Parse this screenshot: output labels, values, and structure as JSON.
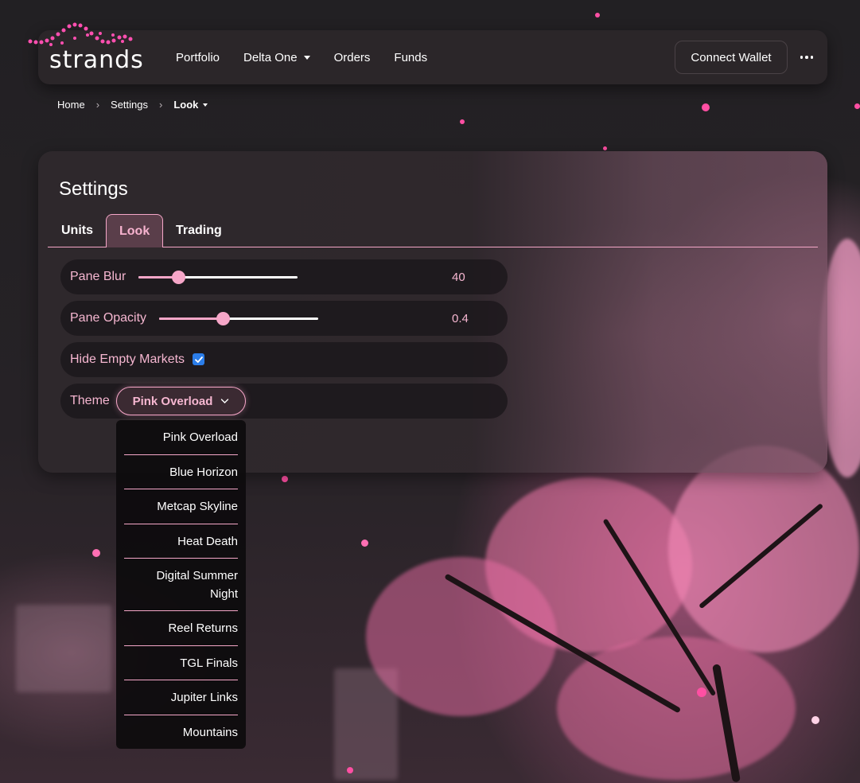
{
  "header": {
    "logo_text": "strands",
    "nav": [
      {
        "label": "Portfolio"
      },
      {
        "label": "Delta One",
        "has_dropdown": true
      },
      {
        "label": "Orders"
      },
      {
        "label": "Funds"
      }
    ],
    "connect_wallet_label": "Connect Wallet",
    "more_icon": "more-horizontal-icon"
  },
  "breadcrumb": {
    "items": [
      "Home",
      "Settings"
    ],
    "current": "Look",
    "separator_icon": "chevron-right-icon"
  },
  "settings": {
    "title": "Settings",
    "tabs": [
      "Units",
      "Look",
      "Trading"
    ],
    "active_tab": "Look",
    "pane_blur": {
      "label": "Pane Blur",
      "value": "40",
      "level": 0.25
    },
    "pane_opacity": {
      "label": "Pane Opacity",
      "value": "0.4",
      "level": 0.4
    },
    "hide_empty_markets": {
      "label": "Hide Empty Markets",
      "checked": true
    },
    "theme": {
      "label": "Theme",
      "selected": "Pink Overload"
    }
  },
  "theme_options": [
    "Pink Overload",
    "Blue Horizon",
    "Metcap Skyline",
    "Heat Death",
    "Digital Summer Night",
    "Reel Returns",
    "TGL Finals",
    "Jupiter Links",
    "Mountains"
  ],
  "colors": {
    "accent_pink": "#f6a6c8",
    "panel_bg": "#2e282c",
    "checkbox_blue": "#2b7de9"
  }
}
